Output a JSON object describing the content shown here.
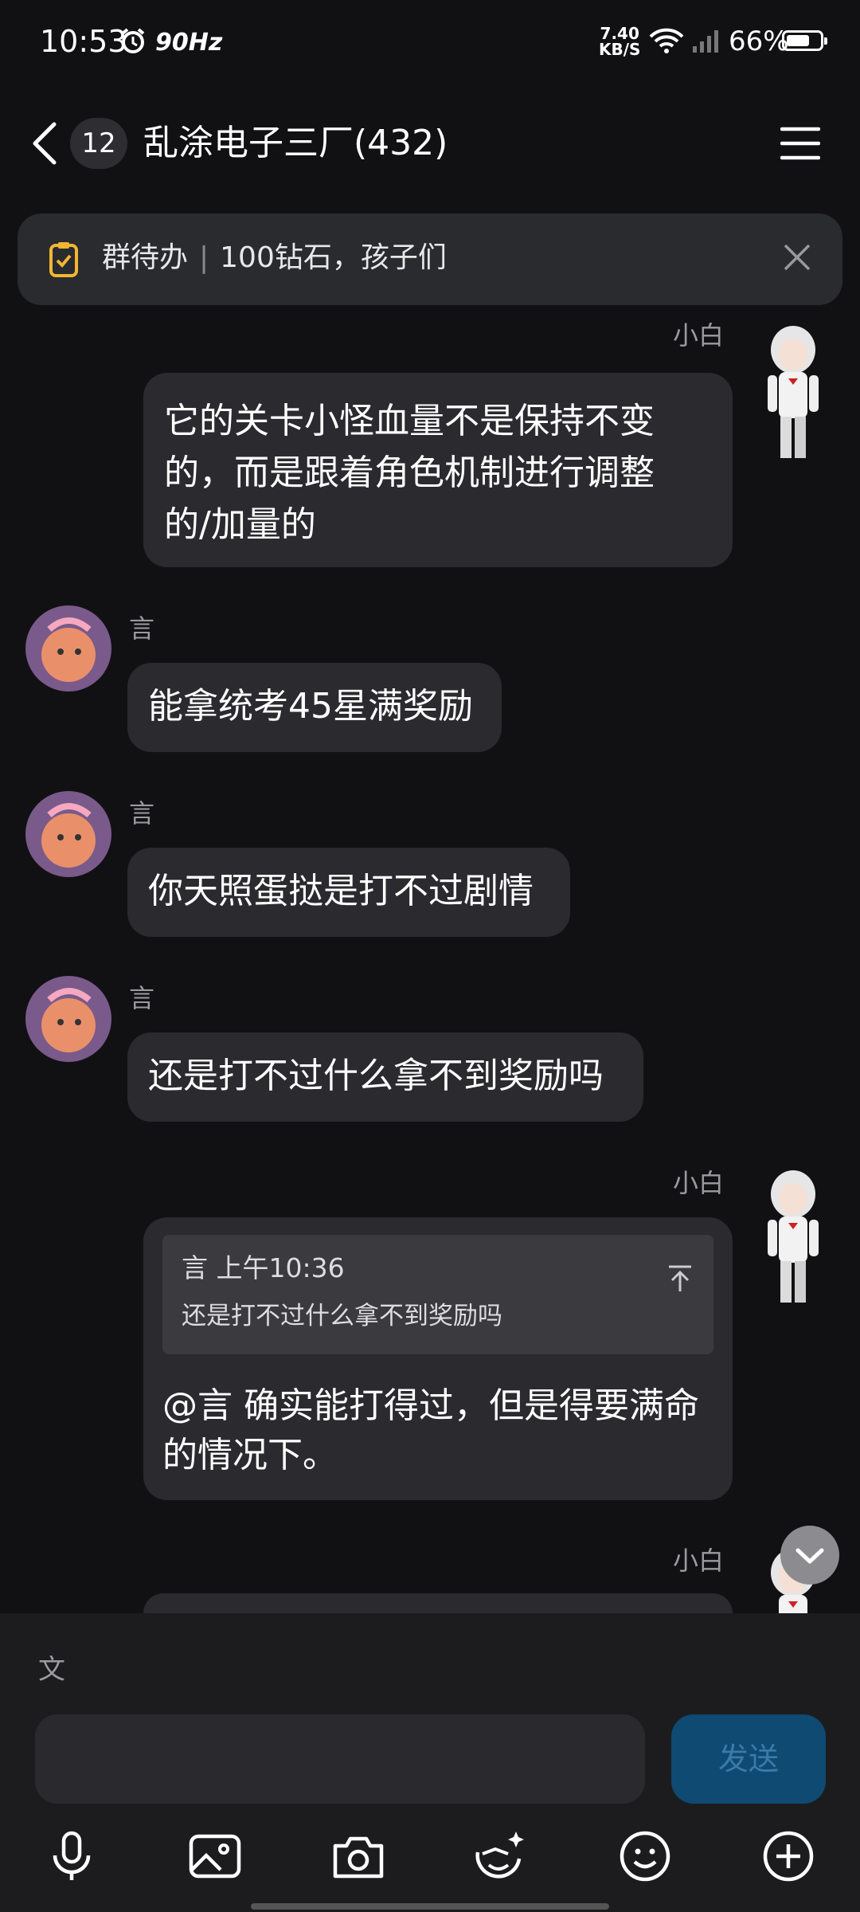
{
  "status_bar": {
    "time": "10:53",
    "refresh_rate": "90Hz",
    "net_speed_value": "7.40",
    "net_speed_unit": "KB/S",
    "battery": "66%",
    "battery_level": 0.66
  },
  "header": {
    "unread_count": "12",
    "title": "乱涂电子三厂(432)"
  },
  "todo_banner": {
    "label": "群待办",
    "text": "100钻石，孩子们"
  },
  "messages": [
    {
      "sender": "小白",
      "side": "right",
      "text_lines": [
        "它的关卡小怪血量不是保持不变",
        "的，而是跟着角色机制进行调整",
        "的/加量的"
      ]
    },
    {
      "sender": "言",
      "side": "left",
      "text": "能拿统考45星满奖励"
    },
    {
      "sender": "言",
      "side": "left",
      "text": "你天照蛋挞是打不过剧情"
    },
    {
      "sender": "言",
      "side": "left",
      "text": "还是打不过什么拿不到奖励吗"
    },
    {
      "sender": "小白",
      "side": "right",
      "quote_header": "言 上午10:36",
      "quote_text": "还是打不过什么拿不到奖励吗",
      "text_lines": [
        "@言 确实能打得过，但是得要满命",
        "的情况下。"
      ]
    },
    {
      "sender": "小白",
      "side": "right",
      "text": ""
    }
  ],
  "input": {
    "translate_icon": "文",
    "placeholder": "",
    "send_label": "发送"
  },
  "toolbar": [
    "mic-icon",
    "image-icon",
    "camera-icon",
    "sticker-icon",
    "emoji-icon",
    "plus-icon"
  ],
  "colors": {
    "background": "#111114",
    "bubble": "#2b2b2f",
    "send_button": "#0f4a73",
    "todo_icon": "#f2b632"
  }
}
